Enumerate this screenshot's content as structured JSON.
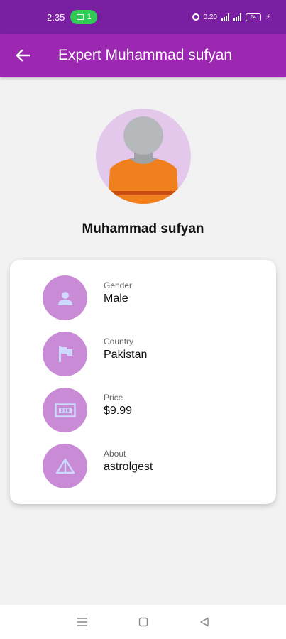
{
  "status_bar": {
    "time": "2:35",
    "badge_count": "1",
    "net_speed": "0.20",
    "battery": "64"
  },
  "app_bar": {
    "title": "Expert Muhammad sufyan"
  },
  "profile": {
    "name": "Muhammad sufyan"
  },
  "details": [
    {
      "label": "Gender",
      "value": "Male",
      "icon": "person-icon"
    },
    {
      "label": "Country",
      "value": "Pakistan",
      "icon": "flag-icon"
    },
    {
      "label": "Price",
      "value": "$9.99",
      "icon": "money-icon"
    },
    {
      "label": "About",
      "value": "astrolgest",
      "icon": "pyramid-icon"
    }
  ],
  "colors": {
    "status_bar": "#7b1fa2",
    "app_bar": "#9c27b0",
    "icon_circle": "#c98ad6",
    "icon_glyph": "#cdd9ff"
  }
}
